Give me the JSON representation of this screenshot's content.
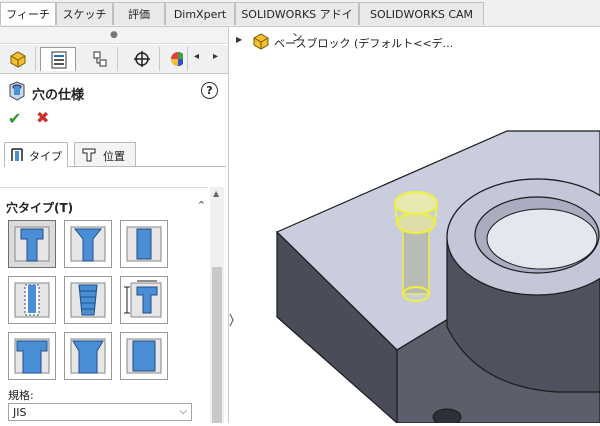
{
  "command_tabs": [
    "フィーチャー",
    "スケッチ",
    "評価",
    "DimXpert",
    "SOLIDWORKS アドイン",
    "SOLIDWORKS CAM"
  ],
  "manager_arrows": {
    "left": "◂",
    "right": "▸"
  },
  "property_manager": {
    "title": "穴の仕様",
    "help": "?",
    "ok": "✔",
    "cancel": "✖",
    "tabs": [
      "タイプ",
      "位置"
    ],
    "section_title": "穴タイプ(T)",
    "hole_types": [
      "counterbore",
      "countersink",
      "hole",
      "straight-tap",
      "tapered-tap",
      "legacy",
      "counterbore-slot",
      "countersink-slot",
      "slot"
    ],
    "standard_label": "規格:",
    "standard_value": "JIS"
  },
  "feature_tree": {
    "root": "ベースブロック (デフォルト<<デ..."
  },
  "colors": {
    "accent_blue": "#4a8fd6",
    "ok_green": "#2a9a2a",
    "cancel_red": "#d03030",
    "highlight": "#f0f040"
  }
}
